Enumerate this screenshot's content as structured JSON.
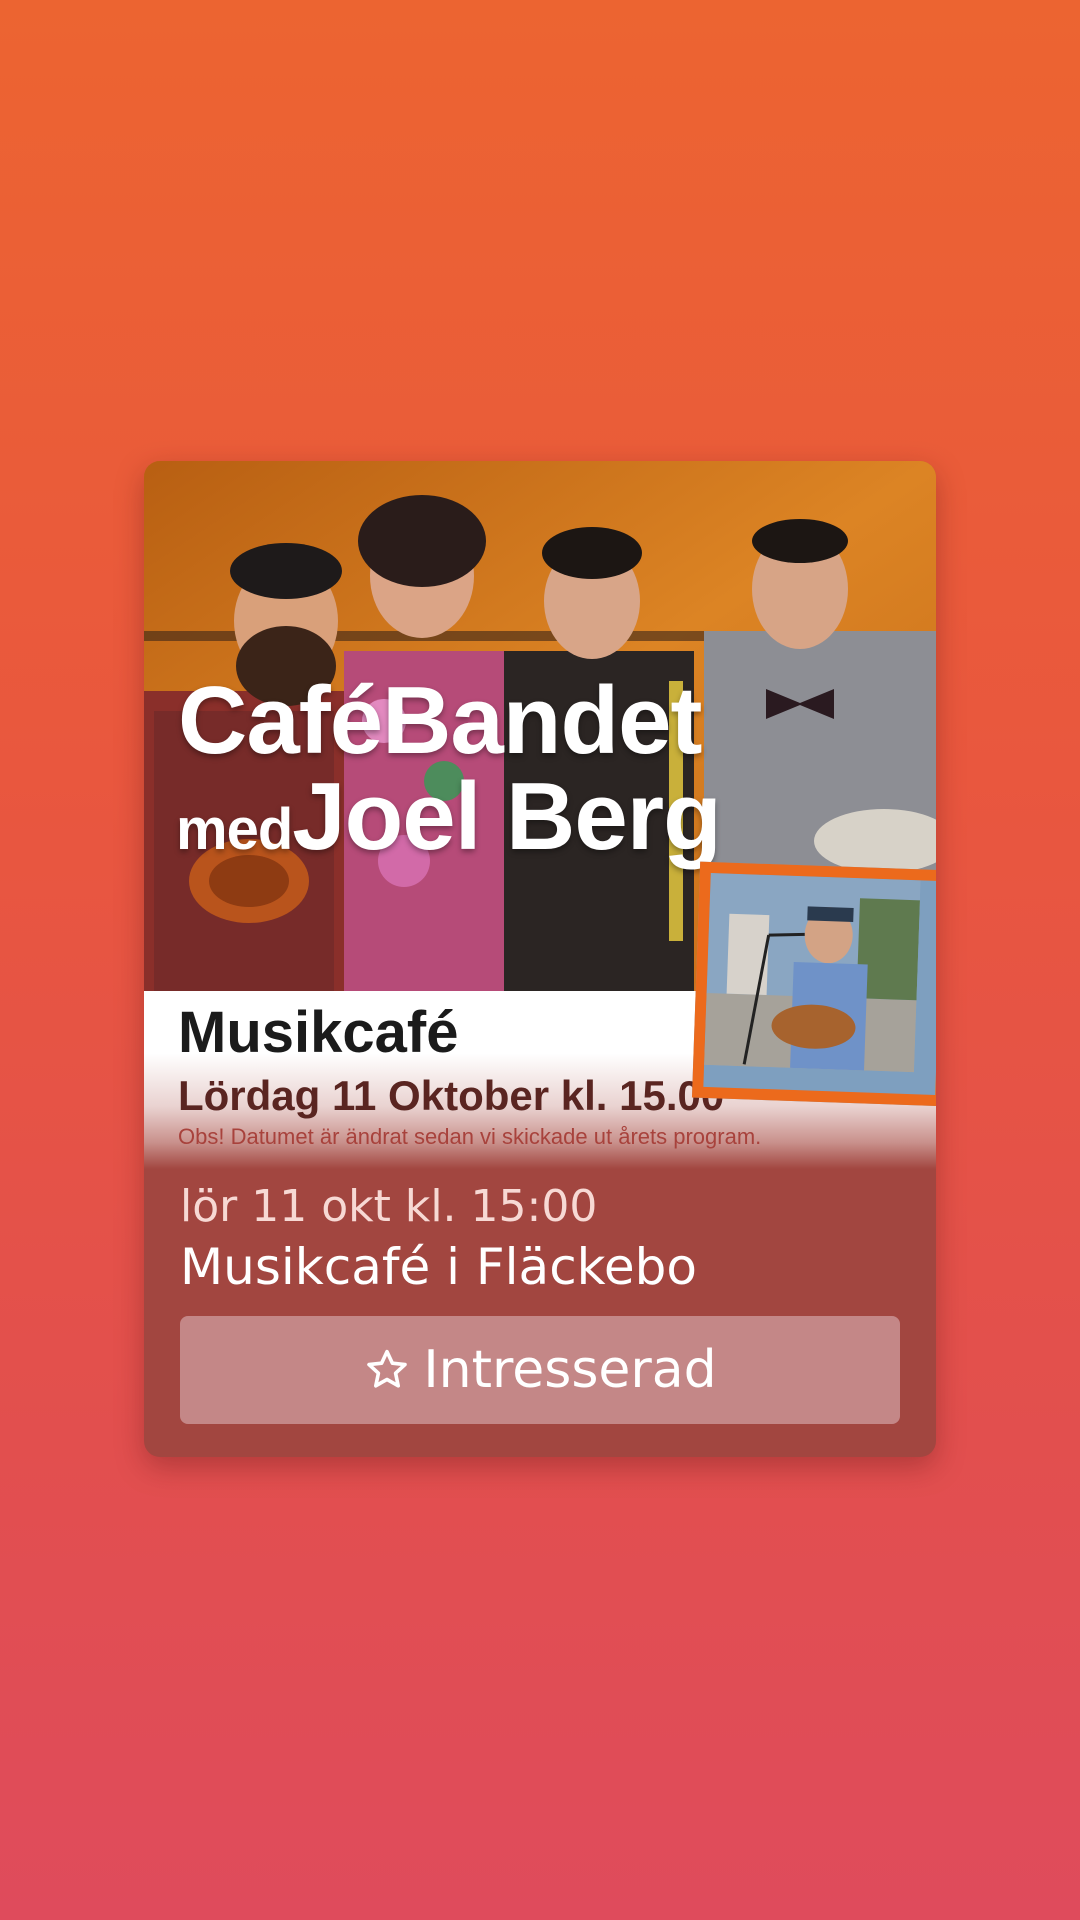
{
  "event_card": {
    "poster": {
      "title_line1": "CaféBandet",
      "title_line2_prefix": "med",
      "title_line2_main": "Joel Berg",
      "heading": "Musikcafé",
      "date_text": "Lördag 11 Oktober kl. 15.00",
      "note": "Obs! Datumet är ändrat sedan vi skickade ut årets program."
    },
    "date_line": "lör 11 okt kl. 15:00",
    "title": "Musikcafé i Fläckebo",
    "interest_button": {
      "label": "Intresserad",
      "icon": "star-outline-icon"
    }
  },
  "colors": {
    "background_top": "#ec6431",
    "background_bottom": "#df4b5c",
    "card": "#a24640",
    "button": "#c48787",
    "inset_frame": "#ec6a1c"
  }
}
